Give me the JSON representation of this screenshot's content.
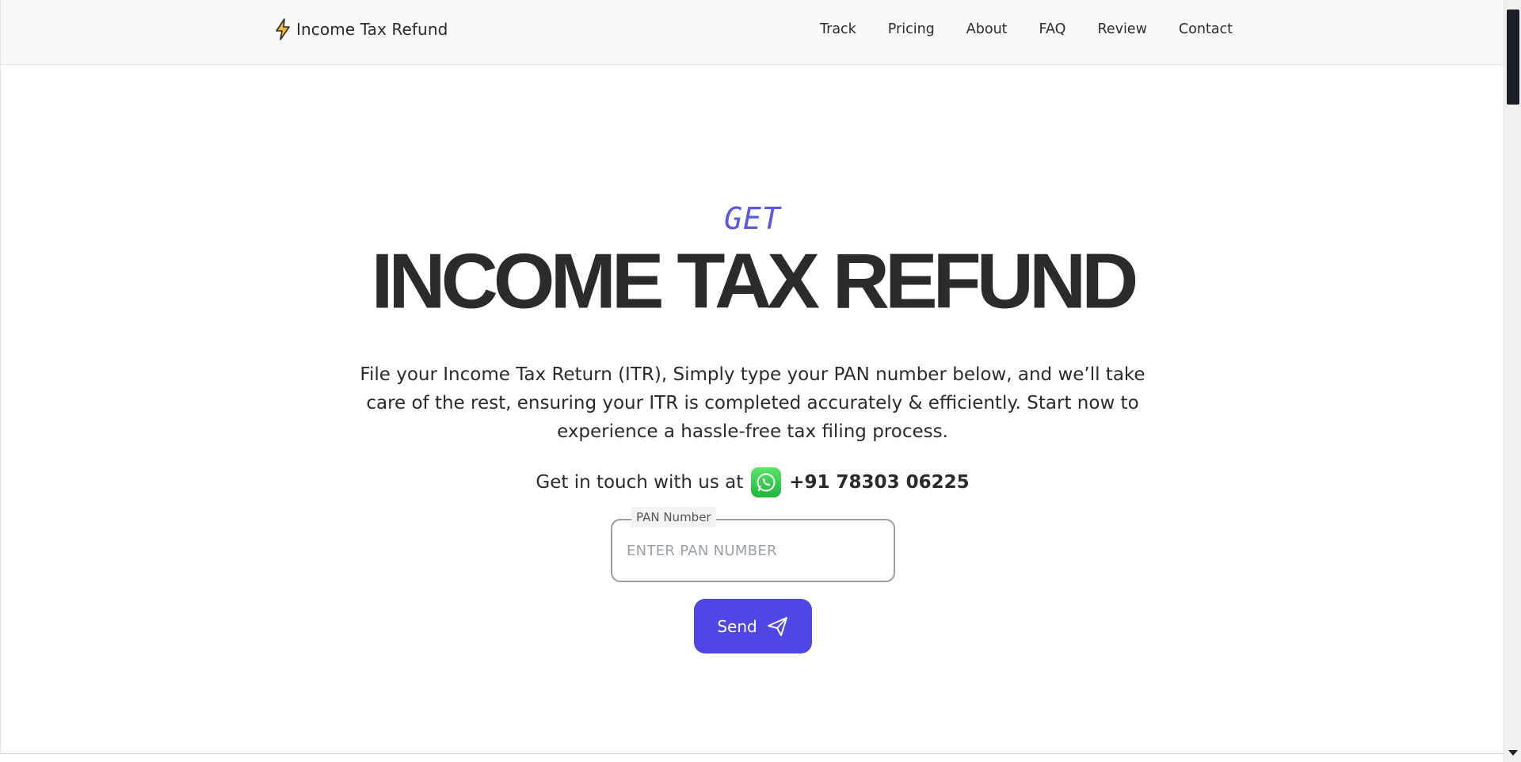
{
  "header": {
    "brand": {
      "icon": "lightning-bolt-icon",
      "label": "Income Tax Refund"
    },
    "nav": [
      "Track",
      "Pricing",
      "About",
      "FAQ",
      "Review",
      "Contact"
    ]
  },
  "hero": {
    "kicker": "GET",
    "title": "INCOME TAX REFUND",
    "description": "File your Income Tax Return (ITR), Simply type your PAN number below, and we’ll take care of the rest, ensuring your ITR is completed accurately & efficiently. Start now to experience a hassle-free tax filing process.",
    "contact_prefix": "Get in touch with us at",
    "contact_icon": "whatsapp-icon",
    "phone": "+91 78303 06225"
  },
  "form": {
    "pan_label": "PAN Number",
    "pan_placeholder": "ENTER PAN NUMBER",
    "pan_value": "",
    "send_label": "Send",
    "send_icon": "paper-plane-icon"
  },
  "colors": {
    "accent": "#4f46e5",
    "kicker": "#5b58e6",
    "text": "#2b2b2b",
    "brand_bolt": "#f5b82e",
    "whatsapp": "#25d366"
  }
}
